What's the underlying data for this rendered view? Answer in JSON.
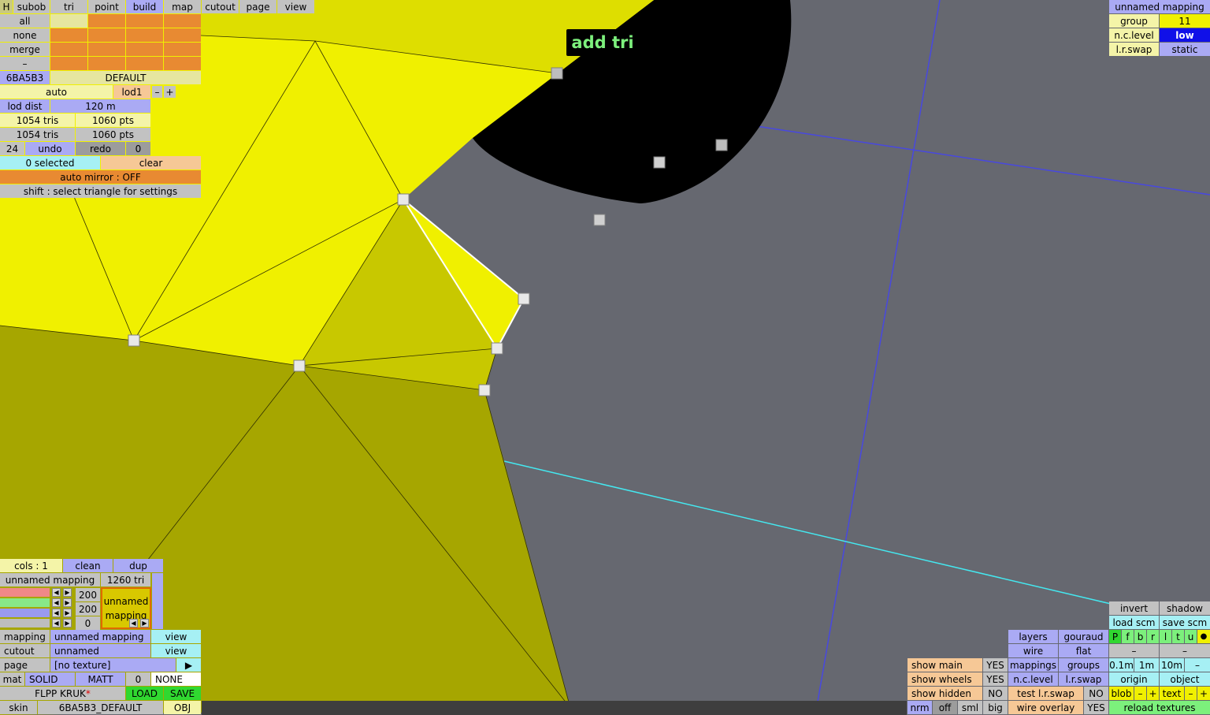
{
  "toolbar": {
    "h": "H",
    "modes": [
      "subob",
      "tri",
      "point",
      "build",
      "map",
      "cutout",
      "page",
      "view"
    ],
    "active_mode": "build"
  },
  "tooltip": "add tri",
  "select": {
    "all": "all",
    "none": "none",
    "merge": "merge",
    "minus": "–"
  },
  "object": {
    "id": "6BA5B3",
    "name": "DEFAULT",
    "auto": "auto",
    "lod": "lod1",
    "lod_minus": "–",
    "lod_plus": "+",
    "lod_dist_label": "lod dist",
    "lod_dist_value": "120 m",
    "tris_1": "1054 tris",
    "pts_1": "1060 pts",
    "tris_2": "1054 tris",
    "pts_2": "1060 pts",
    "undo_count": "24",
    "undo": "undo",
    "redo": "redo",
    "redo_count": "0",
    "selected": "0 selected",
    "clear": "clear",
    "auto_mirror": "auto mirror : OFF",
    "hint": "shift : select triangle for settings"
  },
  "right_top": {
    "mapping": "unnamed mapping",
    "group_label": "group",
    "group_value": "11",
    "nc_label": "n.c.level",
    "nc_value": "low",
    "lr_label": "l.r.swap",
    "lr_value": "static"
  },
  "bottom_left": {
    "cols": "cols : 1",
    "clean": "clean",
    "dup": "dup",
    "mapping_name": "unnamed mapping",
    "tri_count": "1260 tri",
    "num_a": "200",
    "num_b": "200",
    "num_c": "0",
    "map_preview_1": "unnamed",
    "map_preview_2": "mapping",
    "mapping_label": "mapping",
    "mapping_value": "unnamed mapping",
    "mapping_view": "view",
    "cutout_label": "cutout",
    "cutout_value": "unnamed",
    "cutout_view": "view",
    "page_label": "page",
    "page_value": "[no texture]",
    "page_arrow": "▶",
    "mat": "mat",
    "solid": "SOLID",
    "matt": "MATT",
    "mat_num": "0",
    "none": "NONE",
    "file_name": "FLPP KRUK",
    "modified_mark": "*",
    "load": "LOAD",
    "save": "SAVE",
    "skin_label": "skin",
    "skin_value": "6BA5B3_DEFAULT",
    "obj": "OBJ"
  },
  "bottom_right": {
    "show_main": "show main",
    "show_main_v": "YES",
    "show_wheels": "show wheels",
    "show_wheels_v": "YES",
    "show_hidden": "show hidden",
    "show_hidden_v": "NO",
    "nrm": "nrm",
    "off": "off",
    "sml": "sml",
    "big": "big",
    "layers": "layers",
    "gouraud": "gouraud",
    "wire": "wire",
    "flat": "flat",
    "mappings": "mappings",
    "groups": "groups",
    "nc_level": "n.c.level",
    "lr_swap": "l.r.swap",
    "test_lr": "test l.r.swap",
    "test_lr_v": "NO",
    "wire_overlay": "wire overlay",
    "wire_overlay_v": "YES",
    "invert": "invert",
    "shadow": "shadow",
    "load_scm": "load scm",
    "save_scm": "save scm",
    "flags": [
      "P",
      "f",
      "b",
      "r",
      "l",
      "t",
      "u"
    ],
    "dot": "●",
    "dash1": "–",
    "dash2": "–",
    "s01": "0.1m",
    "s1": "1m",
    "s10": "10m",
    "sminus": "–",
    "origin": "origin",
    "object": "object",
    "blob": "blob",
    "blob_minus": "–",
    "blob_plus": "+",
    "text": "text",
    "text_minus": "–",
    "text_plus": "+",
    "reload": "reload textures"
  },
  "colors": {
    "background": "#666870",
    "mesh_bright": "#f0f000",
    "mesh_dark": "#a6a600",
    "selection_accent": "#e88a32",
    "active_mode": "#9c9cf0"
  }
}
